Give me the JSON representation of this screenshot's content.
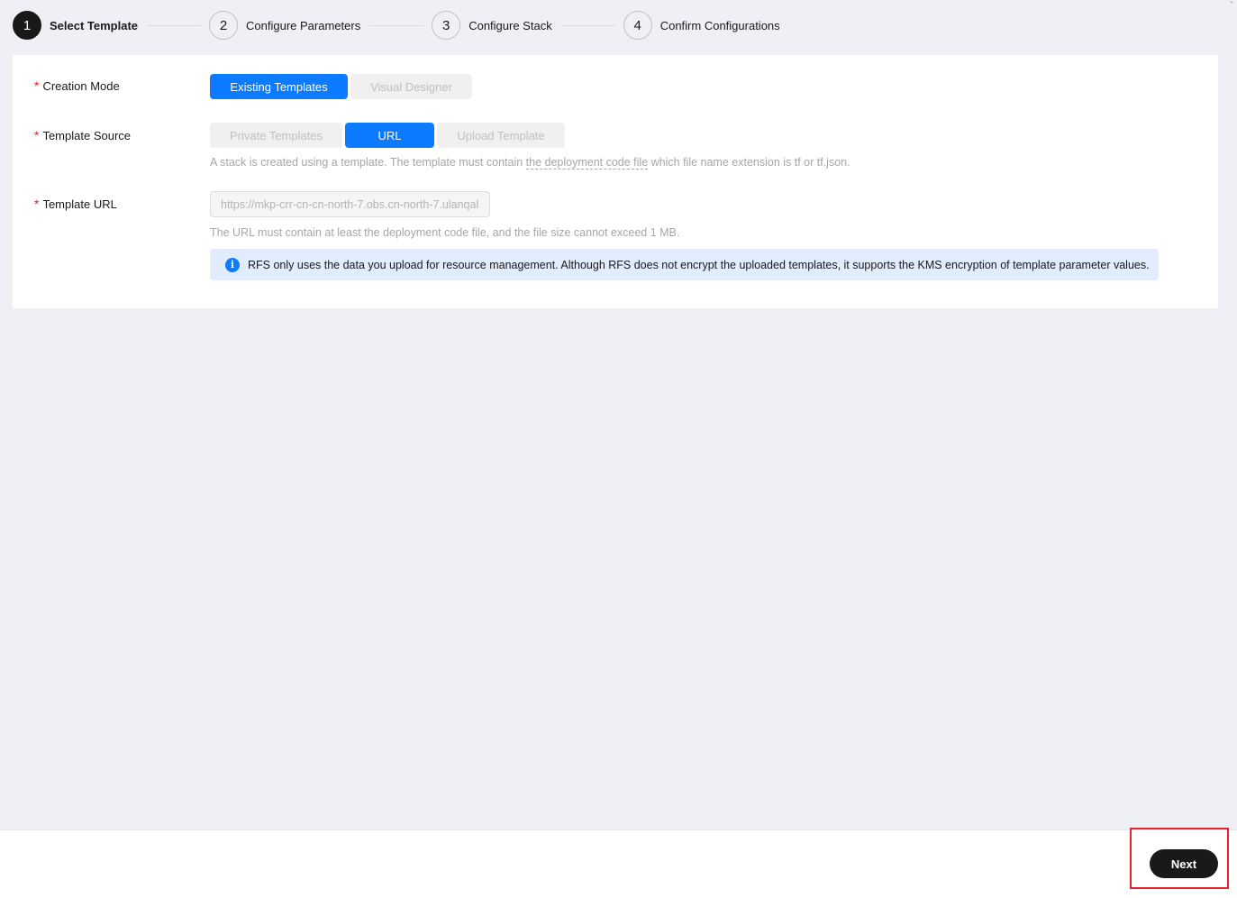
{
  "steps": [
    {
      "number": "1",
      "label": "Select Template",
      "active": true
    },
    {
      "number": "2",
      "label": "Configure Parameters",
      "active": false
    },
    {
      "number": "3",
      "label": "Configure Stack",
      "active": false
    },
    {
      "number": "4",
      "label": "Confirm Configurations",
      "active": false
    }
  ],
  "form": {
    "required_mark": "*",
    "creation_mode": {
      "label": "Creation Mode",
      "options": [
        "Existing Templates",
        "Visual Designer"
      ],
      "selected": "Existing Templates"
    },
    "template_source": {
      "label": "Template Source",
      "options": [
        "Private Templates",
        "URL",
        "Upload Template"
      ],
      "selected": "URL",
      "helper_prefix": "A stack is created using a template. The template must contain ",
      "helper_link": "the deployment code file",
      "helper_suffix": " which file name extension is tf or tf.json."
    },
    "template_url": {
      "label": "Template URL",
      "value": "",
      "placeholder": "https://mkp-crr-cn-cn-north-7.obs.cn-north-7.ulanqal",
      "helper": "The URL must contain at least the deployment code file, and the file size cannot exceed 1 MB."
    },
    "info": {
      "icon": "info-icon",
      "text": "RFS only uses the data you upload for resource management. Although RFS does not encrypt the uploaded templates, it supports the KMS encryption of template parameter values."
    }
  },
  "footer": {
    "next_label": "Next"
  },
  "colors": {
    "accent": "#0d7bff",
    "primary_dark": "#191919",
    "required": "#e5242b",
    "highlight": "#e5242b",
    "info_bg": "#e1ecfd",
    "page_bg": "#eff0f5"
  }
}
